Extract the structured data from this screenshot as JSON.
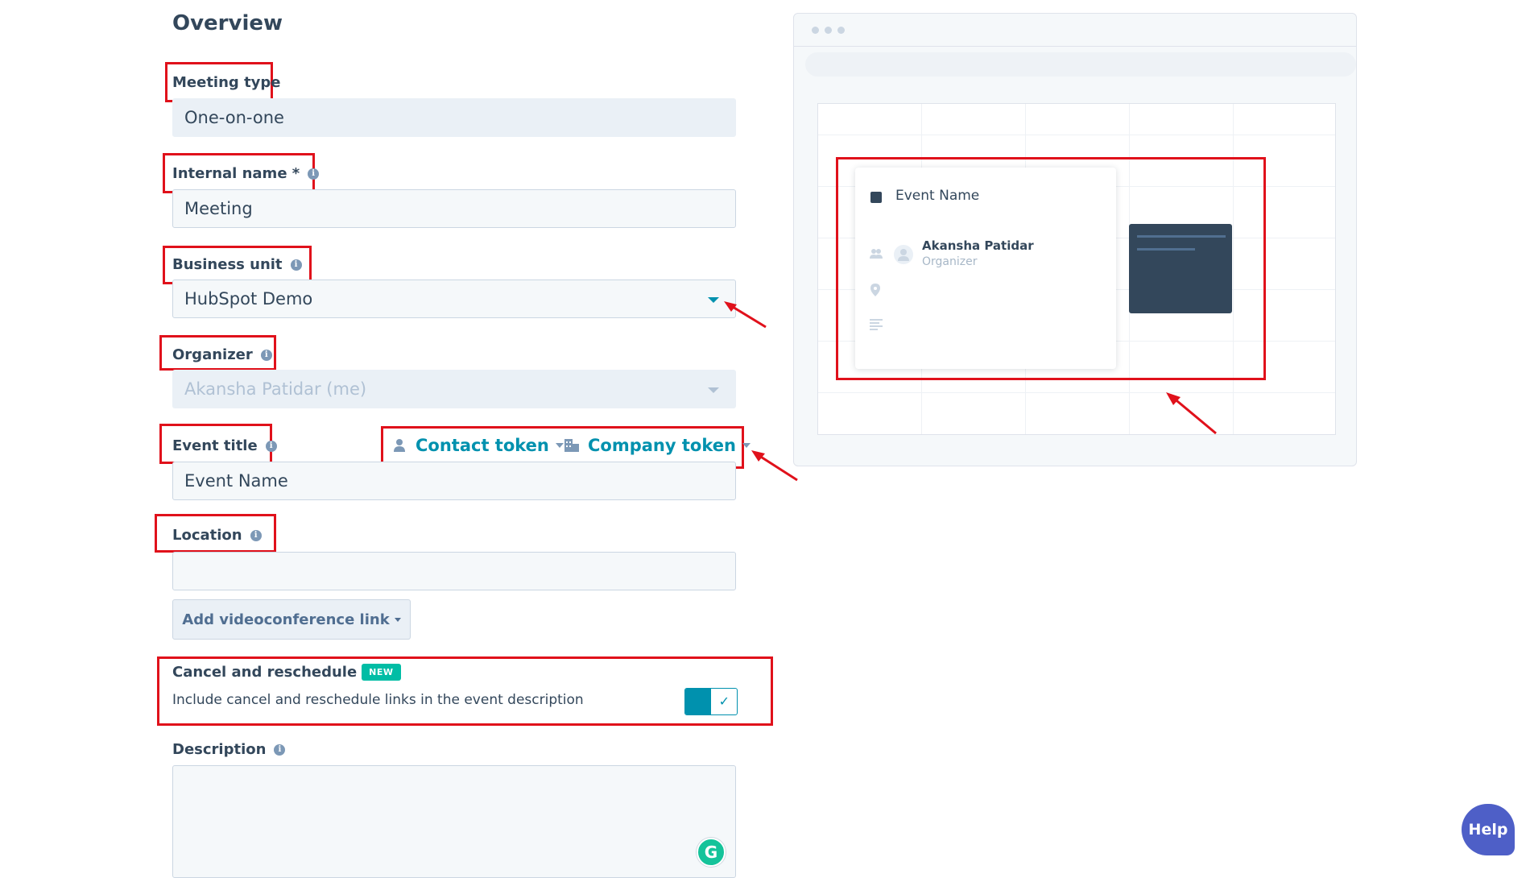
{
  "overview": {
    "title": "Overview"
  },
  "meeting_type": {
    "label": "Meeting type",
    "value": "One-on-one"
  },
  "internal_name": {
    "label": "Internal name *",
    "value": "Meeting"
  },
  "business_unit": {
    "label": "Business unit",
    "value": "HubSpot Demo"
  },
  "organizer": {
    "label": "Organizer",
    "value": "Akansha Patidar (me)"
  },
  "event_title": {
    "label": "Event title",
    "value": "Event Name",
    "contact_token": "Contact token",
    "company_token": "Company token"
  },
  "location": {
    "label": "Location",
    "value": "",
    "videoconference_button": "Add videoconference link"
  },
  "cancel_reschedule": {
    "label": "Cancel and reschedule",
    "badge": "NEW",
    "description": "Include cancel and reschedule links in the event description",
    "toggle_on": true
  },
  "description": {
    "label": "Description",
    "value": ""
  },
  "preview": {
    "event_name": "Event Name",
    "person_name": "Akansha Patidar",
    "person_role": "Organizer"
  },
  "help": {
    "label": "Help"
  },
  "grammarly": {
    "letter": "G"
  },
  "colors": {
    "accent": "#0091ae",
    "annotation_red": "#e0111b",
    "badge": "#00bda5",
    "text": "#33475b"
  },
  "icons": [
    "info-icon",
    "contact-icon",
    "company-icon",
    "dropdown-caret-icon",
    "checkmark-icon",
    "attendees-icon",
    "location-pin-icon",
    "description-lines-icon",
    "grammarly-icon"
  ]
}
